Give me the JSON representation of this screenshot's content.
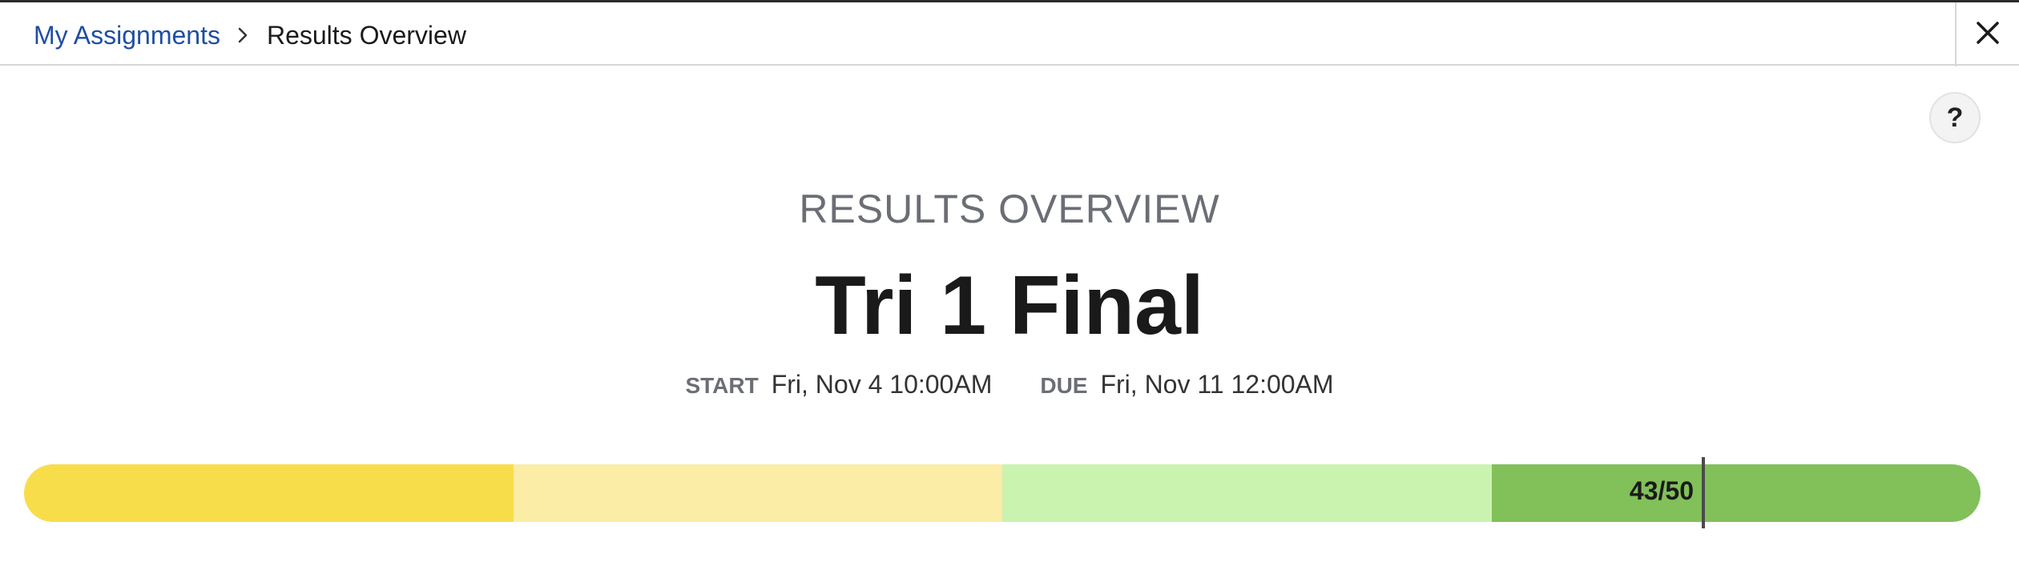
{
  "breadcrumb": {
    "parent": "My Assignments",
    "current": "Results Overview"
  },
  "header": {
    "overline": "RESULTS OVERVIEW",
    "title": "Tri 1 Final"
  },
  "dates": {
    "start_label": "START",
    "start_value": "Fri, Nov 4 10:00AM",
    "due_label": "DUE",
    "due_value": "Fri, Nov 11 12:00AM"
  },
  "help": {
    "label": "?"
  },
  "score": {
    "label": "43/50",
    "earned": 43,
    "total": 50
  },
  "colors": {
    "segment_1": "#f8dd4b",
    "segment_2": "#fbeca6",
    "segment_3": "#caf3b0",
    "segment_4": "#82c05a",
    "link": "#1f4ea3"
  },
  "icons": {
    "breadcrumb_separator": "chevron-right-icon",
    "close": "close-icon"
  }
}
